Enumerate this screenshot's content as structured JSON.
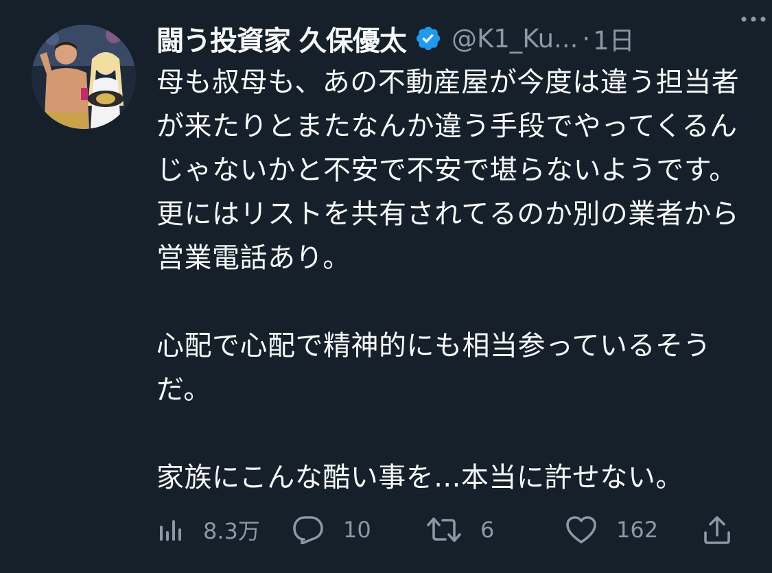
{
  "author": {
    "display_name": "闘う投資家 久保優太",
    "handle": "@K1_Ku...",
    "separator": "·",
    "time": "1日",
    "verified": true,
    "verified_color": "#1d9bf0"
  },
  "tweet": {
    "paragraphs": [
      "母も叔母も、あの不動産屋が今度は違う担当者が来たりとまたなんか違う手段でやってくるんじゃないかと不安で不安で堪らないようです。\n更にはリストを共有されてるのか別の業者から営業電話あり。",
      "心配で心配で精神的にも相当参っているそうだ。",
      "家族にこんな酷い事を...本当に許せない。"
    ]
  },
  "actions": {
    "views": {
      "icon": "views-icon",
      "count": "8.3万"
    },
    "reply": {
      "icon": "reply-icon",
      "count": "10"
    },
    "retweet": {
      "icon": "retweet-icon",
      "count": "6"
    },
    "like": {
      "icon": "heart-icon",
      "count": "162"
    },
    "share": {
      "icon": "share-icon"
    }
  },
  "colors": {
    "background": "#15202b",
    "text": "#f7f9f9",
    "muted": "#8b98a5",
    "accent": "#1d9bf0"
  }
}
